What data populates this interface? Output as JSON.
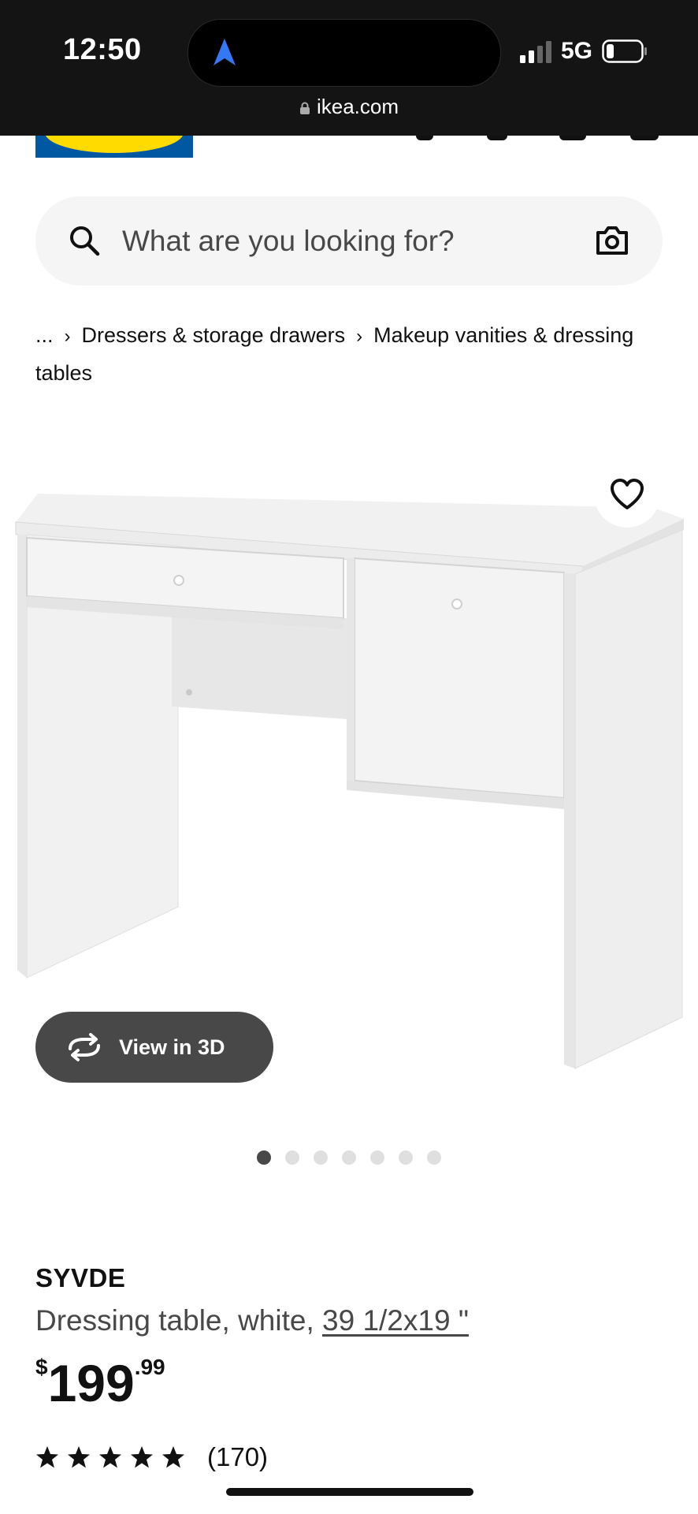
{
  "status_bar": {
    "time": "12:50",
    "network": "5G",
    "url": "ikea.com",
    "icons": [
      "navigation-arrow-icon",
      "signal-icon",
      "battery-icon",
      "lock-icon"
    ]
  },
  "search": {
    "placeholder": "What are you looking for?",
    "icons": [
      "search-icon",
      "camera-icon"
    ]
  },
  "breadcrumb": {
    "items": [
      "...",
      "Dressers & storage drawers",
      "Makeup vanities & dressing tables"
    ]
  },
  "product_image": {
    "view_3d_label": "View in 3D",
    "carousel": {
      "total": 7,
      "active_index": 0
    }
  },
  "product": {
    "name": "SYVDE",
    "description": "Dressing table, white, ",
    "size": "39 1/2x19 \"",
    "price": {
      "currency": "$",
      "dollars": "199",
      "cents": ".99"
    },
    "rating": {
      "stars": 5,
      "max": 5,
      "reviews": "(170)"
    }
  },
  "colors": {
    "status_bar_bg": "#141414",
    "accent_blue": "#0058a3",
    "accent_yellow": "#ffdb00",
    "button_dark": "#484848"
  }
}
